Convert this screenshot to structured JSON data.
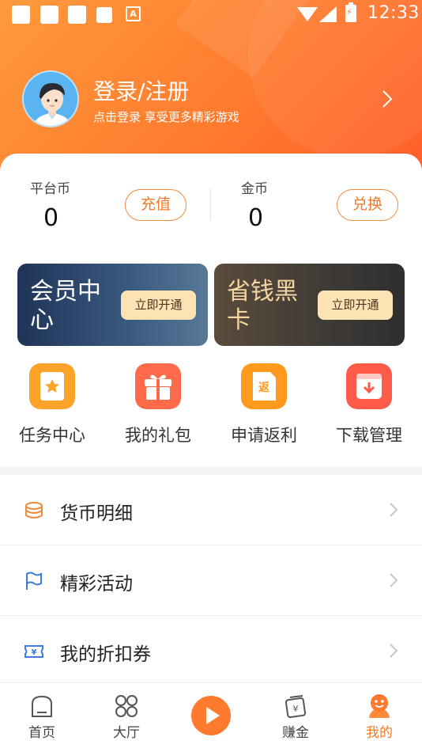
{
  "status_bar": {
    "time": "12:33"
  },
  "profile": {
    "title": "登录/注册",
    "subtitle": "点击登录  享受更多精彩游戏"
  },
  "wallet": {
    "platform_coin": {
      "label": "平台币",
      "value": "0",
      "button": "充值"
    },
    "gold_coin": {
      "label": "金币",
      "value": "0",
      "button": "兑换"
    }
  },
  "promos": [
    {
      "title": "会员中心",
      "button": "立即开通"
    },
    {
      "title": "省钱黑卡",
      "button": "立即开通"
    }
  ],
  "quick_actions": [
    {
      "label": "任务中心",
      "icon": "task-icon"
    },
    {
      "label": "我的礼包",
      "icon": "gift-icon"
    },
    {
      "label": "申请返利",
      "icon": "rebate-icon"
    },
    {
      "label": "下载管理",
      "icon": "download-icon"
    }
  ],
  "menu": [
    {
      "label": "货币明细",
      "icon": "coins-icon"
    },
    {
      "label": "精彩活动",
      "icon": "flag-icon"
    },
    {
      "label": "我的折扣券",
      "icon": "coupon-icon"
    }
  ],
  "tabs": [
    {
      "label": "首页",
      "icon": "home-icon"
    },
    {
      "label": "大厅",
      "icon": "grid-icon"
    },
    {
      "label": "",
      "icon": "play-icon"
    },
    {
      "label": "赚金",
      "icon": "earn-icon"
    },
    {
      "label": "我的",
      "icon": "profile-icon",
      "active": true
    }
  ],
  "colors": {
    "accent": "#ff7a2e",
    "vip_gradient_start": "#1f3457",
    "card_gradient_start": "#5a4c3c"
  }
}
